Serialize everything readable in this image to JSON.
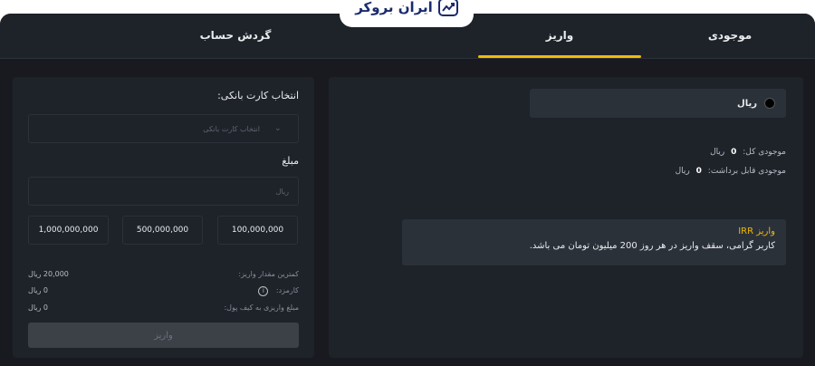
{
  "header": {
    "tabs": [
      {
        "label": "موجودی"
      },
      {
        "label": "واریز"
      },
      {
        "label": "گردش حساب"
      }
    ],
    "logo_text": "ایران بروکر",
    "accent_color": "#f0b90b"
  },
  "right_panel": {
    "currency": {
      "icon": "coin-icon",
      "label": "ریال"
    },
    "balance_total": {
      "label": "موجودی کل:",
      "value": "0",
      "unit": "ریال"
    },
    "balance_withdrawable": {
      "label": "موجودی قابل برداشت:",
      "value": "0",
      "unit": "ریال"
    },
    "notice": {
      "title": "واریز IRR",
      "text": "کاربر گرامی، سقف واریز در هر روز 200 میلیون تومان می باشد."
    }
  },
  "left_panel": {
    "card_label": "انتخاب کارت بانکی:",
    "card_placeholder": "انتخاب کارت بانکی",
    "amount_label": "مبلغ",
    "amount_placeholder": "ریال",
    "quick_amounts": [
      "1,000,000,000",
      "500,000,000",
      "100,000,000"
    ],
    "min_deposit": {
      "label": "کمترین مقدار واریز:",
      "value": "20,000 ریال"
    },
    "fee": {
      "label": "کارمزد:",
      "value": "0 ریال"
    },
    "wallet_amount": {
      "label": "مبلغ واریزی به کیف پول:",
      "value": "0 ریال"
    },
    "submit_label": "واریز"
  }
}
